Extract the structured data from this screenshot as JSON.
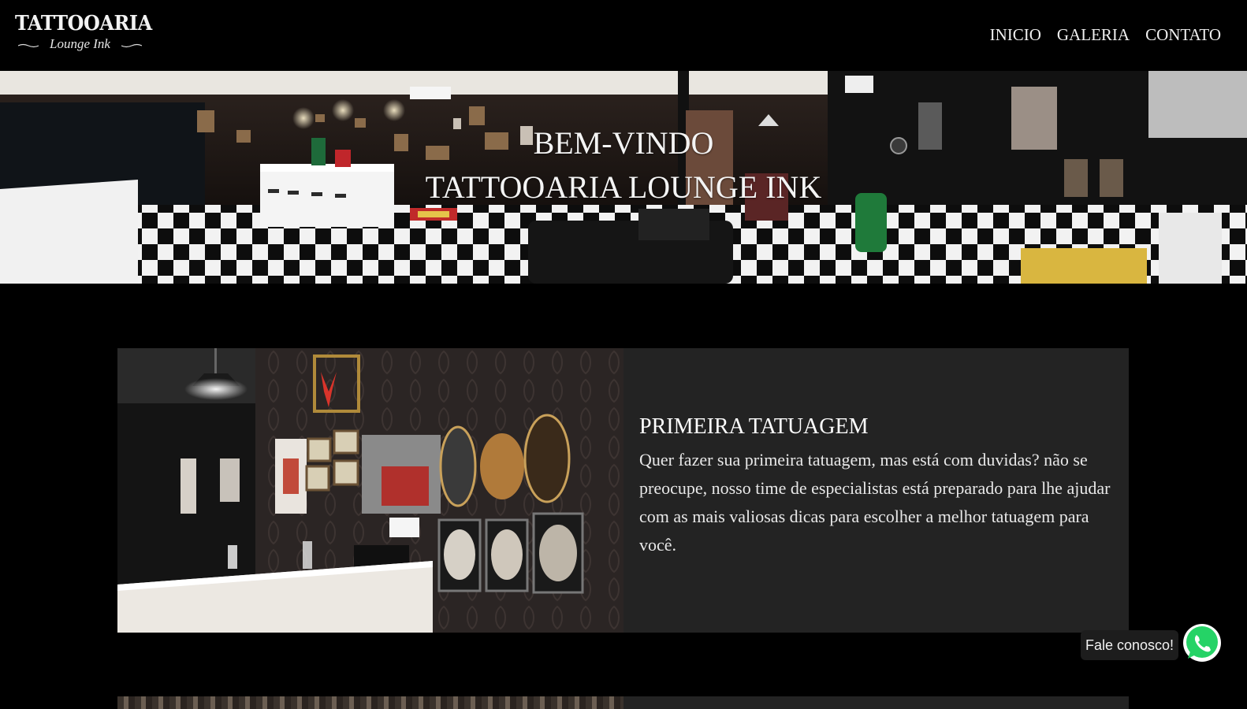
{
  "header": {
    "logo_main": "TATTOOARIA",
    "logo_sub": "Lounge Ink",
    "nav": [
      {
        "label": "INICIO"
      },
      {
        "label": "GALERIA"
      },
      {
        "label": "CONTATO"
      }
    ]
  },
  "hero": {
    "line1": "BEM-VINDO",
    "line2": "TATTOOARIA LOUNGE INK",
    "image_description": "panoramic studio interior"
  },
  "feature": {
    "title": "PRIMEIRA TATUAGEM",
    "text": "Quer fazer sua primeira tatuagem, mas está com duvidas? não se preocupe, nosso time de especialistas está preparado para lhe ajudar com as mais valiosas dicas para escolher a melhor tatuagem para você."
  },
  "whatsapp": {
    "label": "Fale conosco!",
    "icon": "whatsapp-icon",
    "color": "#25D366"
  },
  "colors": {
    "background": "#000000",
    "card": "#232323",
    "text": "#ffffff"
  }
}
